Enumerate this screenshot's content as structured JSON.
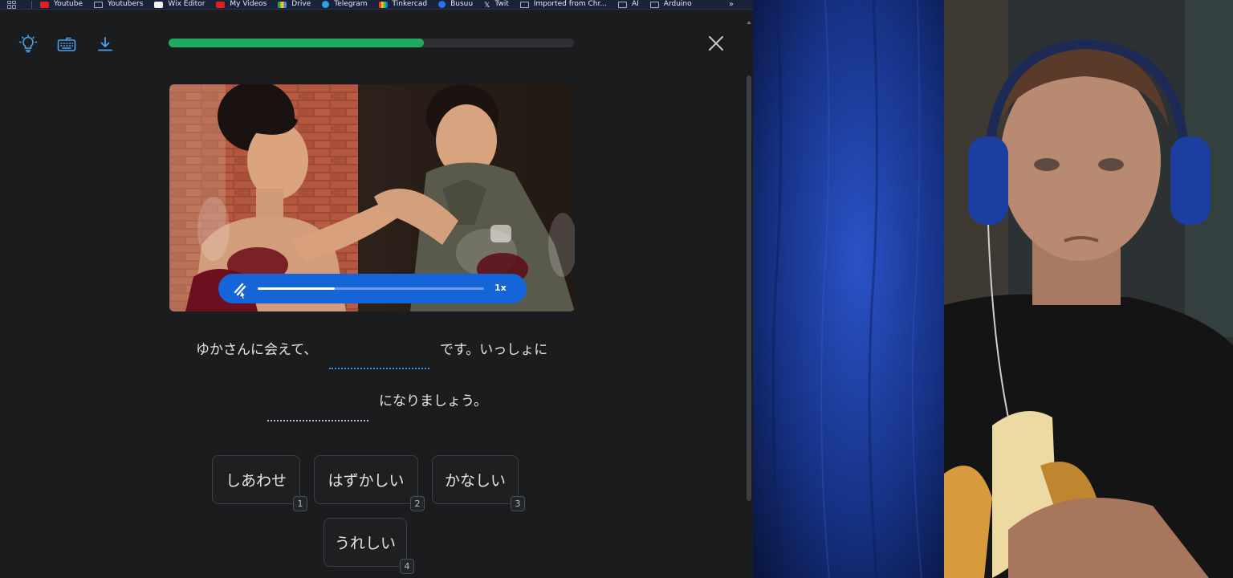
{
  "bookmarks": [
    {
      "label": "Youtube",
      "icon": "youtube-icon"
    },
    {
      "label": "Youtubers",
      "icon": "folder-icon"
    },
    {
      "label": "Wix Editor",
      "icon": "wix-icon"
    },
    {
      "label": "My Videos",
      "icon": "youtube-icon"
    },
    {
      "label": "Drive",
      "icon": "drive-icon"
    },
    {
      "label": "Telegram",
      "icon": "telegram-icon"
    },
    {
      "label": "Tinkercad",
      "icon": "tinkercad-icon"
    },
    {
      "label": "Busuu",
      "icon": "busuu-icon"
    },
    {
      "label": "Twit",
      "icon": "x-icon"
    },
    {
      "label": "Imported from Chr...",
      "icon": "folder-icon"
    },
    {
      "label": "AI",
      "icon": "folder-icon"
    },
    {
      "label": "Arduino",
      "icon": "folder-icon"
    }
  ],
  "bookmarks_more": "»",
  "toolbar": {
    "icons": [
      "lightbulb-icon",
      "keyboard-icon",
      "download-icon"
    ]
  },
  "lesson": {
    "progress": 0.63,
    "accent": "#1eab5e"
  },
  "audio": {
    "progress": 0.34,
    "speed": "1x",
    "color": "#1565d8"
  },
  "sentence": {
    "line1_before": "ゆかさんに会えて、",
    "line1_after": "です。いっしょに",
    "line2_after": "になりましょう。"
  },
  "choices": [
    {
      "label": "しあわせ",
      "key": "1"
    },
    {
      "label": "はずかしい",
      "key": "2"
    },
    {
      "label": "かなしい",
      "key": "3"
    },
    {
      "label": "うれしい",
      "key": "4"
    }
  ]
}
